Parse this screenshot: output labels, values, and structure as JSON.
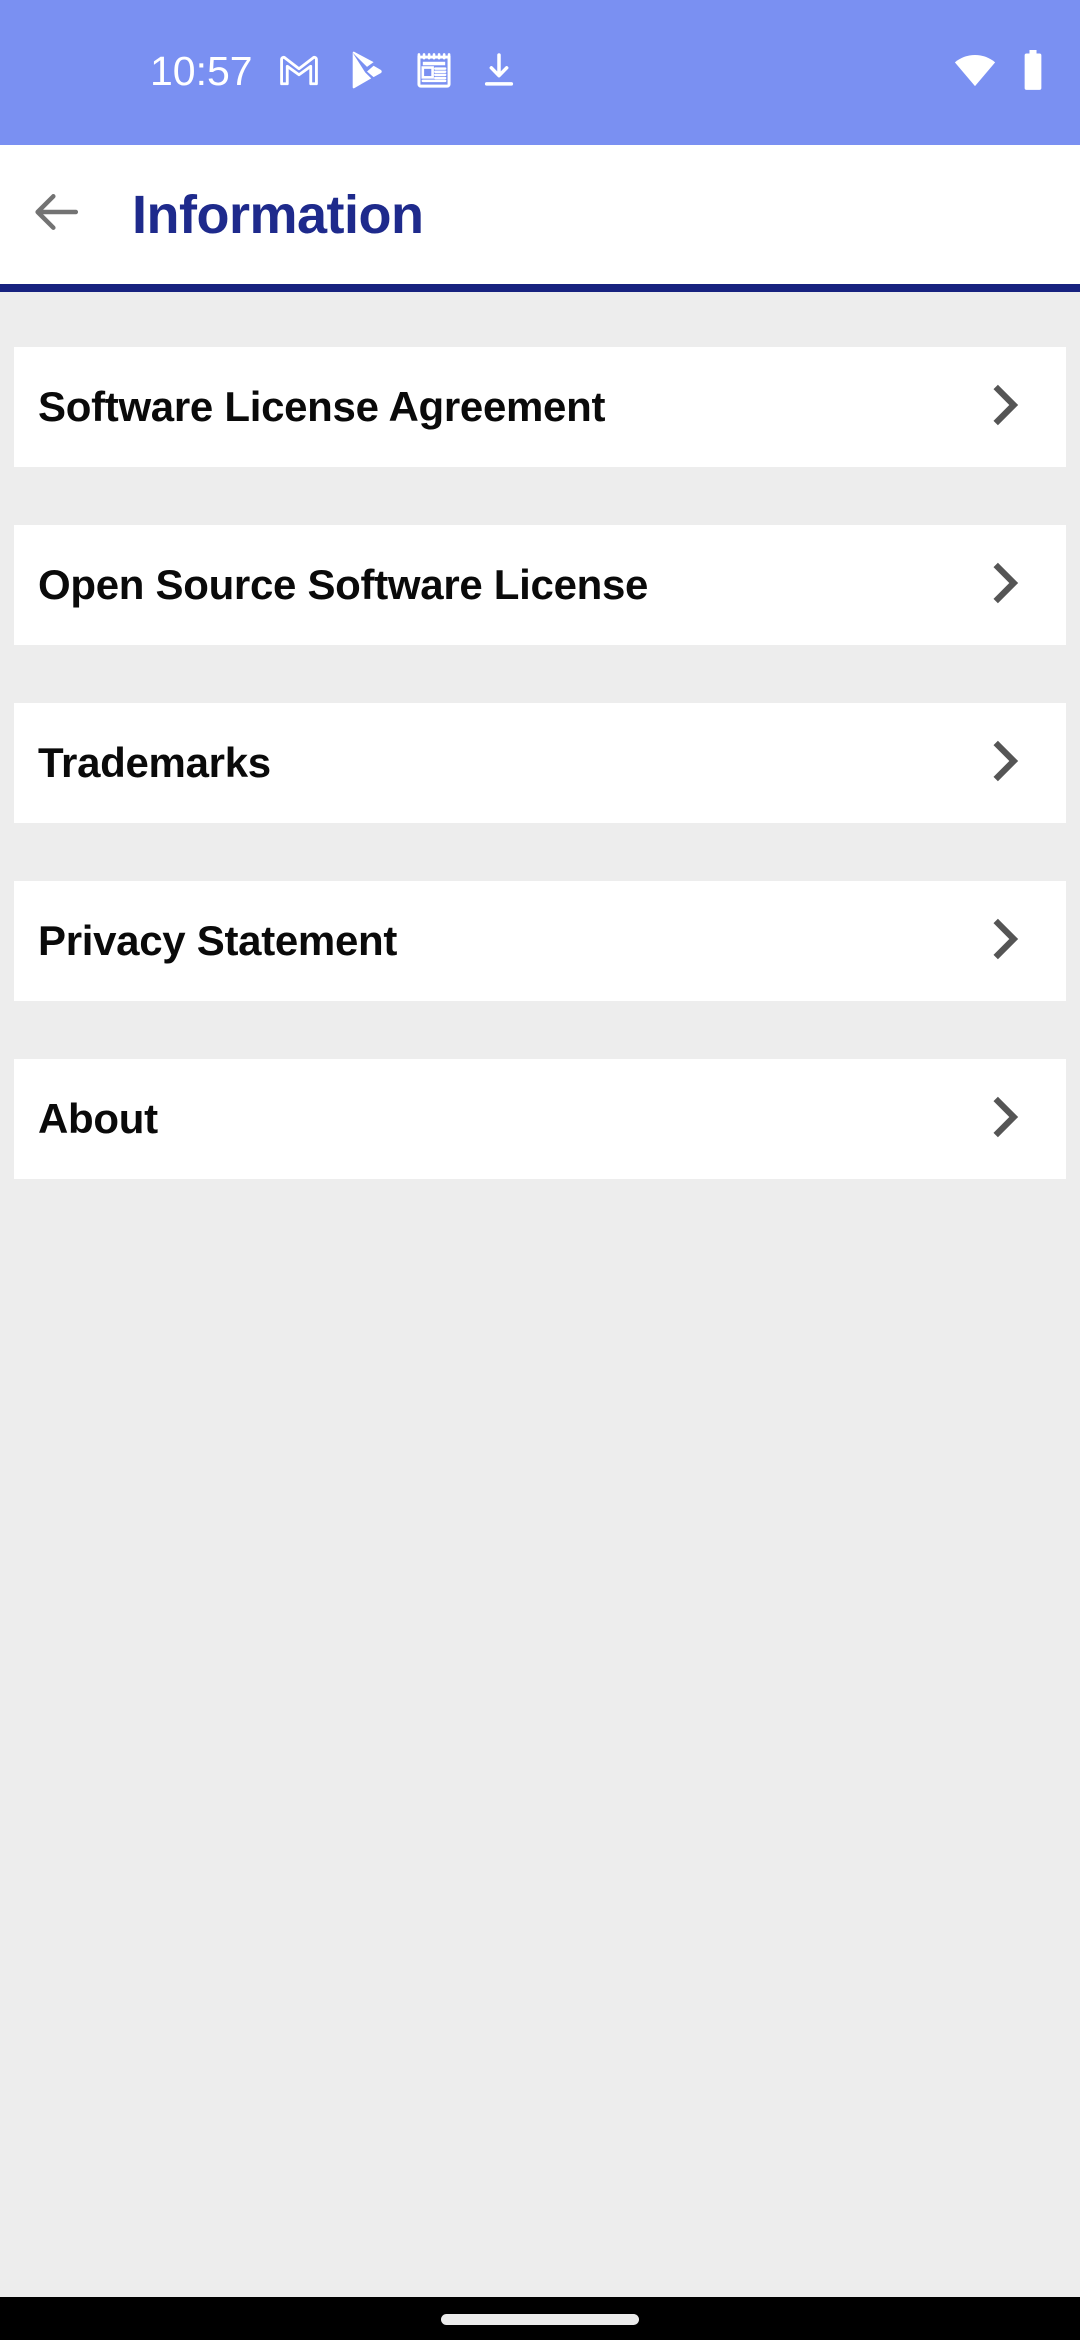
{
  "status_bar": {
    "time": "10:57",
    "background_color": "#7a90f2",
    "icon_color": "#ffffff",
    "notification_icons": [
      "gmail-icon",
      "play-store-icon",
      "news-icon",
      "download-icon"
    ],
    "system_icons": [
      "wifi-icon",
      "battery-icon"
    ]
  },
  "app_bar": {
    "back_icon": "back-arrow-icon",
    "title": "Information",
    "title_color": "#1e2a8c",
    "background_color": "#ffffff",
    "underline_color": "#17227f"
  },
  "page": {
    "background_color": "#ededed",
    "card_color": "#ffffff",
    "chevron_color": "#555555",
    "label_color": "#0a0a0a"
  },
  "list": {
    "items": [
      {
        "label": "Software License Agreement",
        "chevron": "chevron-right-icon"
      },
      {
        "label": "Open Source Software License",
        "chevron": "chevron-right-icon"
      },
      {
        "label": "Trademarks",
        "chevron": "chevron-right-icon"
      },
      {
        "label": "Privacy Statement",
        "chevron": "chevron-right-icon"
      },
      {
        "label": "About",
        "chevron": "chevron-right-icon"
      }
    ]
  },
  "nav_bar": {
    "background_color": "#000000",
    "home_indicator_color": "#ebebeb"
  }
}
